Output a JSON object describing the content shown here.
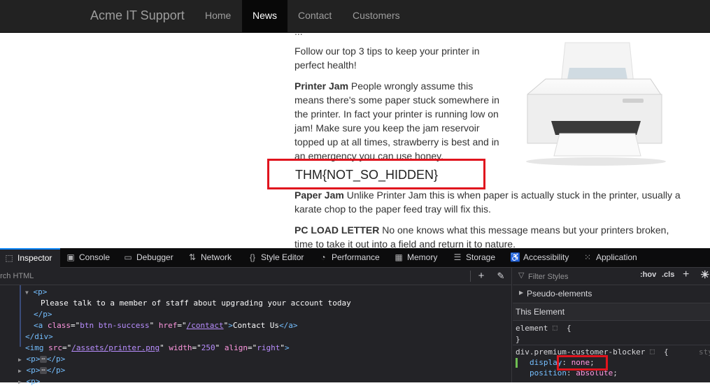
{
  "navbar": {
    "brand": "Acme IT Support",
    "items": [
      {
        "label": "Home"
      },
      {
        "label": "News"
      },
      {
        "label": "Contact"
      },
      {
        "label": "Customers"
      }
    ]
  },
  "article": {
    "top_partial": "...",
    "intro": "Follow our top 3 tips to keep your printer in perfect health!",
    "tips": [
      {
        "title": "Printer Jam",
        "text": " People wrongly assume this means there's some paper stuck somewhere in the printer. In fact your printer is running low on jam! Make sure you keep the jam reservoir topped up at all times, strawberry is best and in an emergency you can use honey."
      },
      {
        "title": "Paper Jam",
        "text": " Unlike Printer Jam this is when paper is actually stuck in the printer, usually a karate chop to the paper feed tray will fix this."
      },
      {
        "title": "PC LOAD LETTER",
        "text": " No one knows what this message means but your printers broken, time to take it out into a field and return it to nature."
      }
    ],
    "flag": "THM{NOT_SO_HIDDEN}"
  },
  "devtools": {
    "tabs": [
      {
        "label": "Inspector",
        "icon": "inspector-icon"
      },
      {
        "label": "Console",
        "icon": "console-icon"
      },
      {
        "label": "Debugger",
        "icon": "debugger-icon"
      },
      {
        "label": "Network",
        "icon": "network-icon"
      },
      {
        "label": "Style Editor",
        "icon": "style-editor-icon"
      },
      {
        "label": "Performance",
        "icon": "performance-icon"
      },
      {
        "label": "Memory",
        "icon": "memory-icon"
      },
      {
        "label": "Storage",
        "icon": "storage-icon"
      },
      {
        "label": "Accessibility",
        "icon": "accessibility-icon"
      },
      {
        "label": "Application",
        "icon": "application-icon"
      }
    ],
    "search_placeholder": "arch HTML",
    "markup": {
      "p_open": "<p>",
      "p_text": "Please talk to a member of staff about upgrading your account today",
      "p_close": "</p>",
      "a_tag": "a",
      "a_class_attr": "class",
      "a_class_val": "btn btn-success",
      "a_href_attr": "href",
      "a_href_val": "/contact",
      "a_text": "Contact Us",
      "a_close": "</a>",
      "div_close": "</div>",
      "img_tag": "img",
      "img_src_attr": "src",
      "img_src_val": "/assets/printer.png",
      "img_width_attr": "width",
      "img_width_val": "250",
      "img_align_attr": "align",
      "img_align_val": "right",
      "p_collapsed": "p",
      "p_bottom": "<p>"
    },
    "rules": {
      "filter_placeholder": "Filter Styles",
      "hov": ":hov",
      "cls": ".cls",
      "pseudo_elements": "Pseudo-elements",
      "this_element": "This Element",
      "element_selector": "element",
      "open_brace": "{",
      "close_brace": "}",
      "premium_selector": "div.premium-customer-blocker",
      "source": "sty",
      "props": [
        {
          "name": "display",
          "value": "none"
        },
        {
          "name": "position",
          "value": "absolute"
        }
      ]
    }
  },
  "colors": {
    "highlight": "#e0141e",
    "navbar_bg": "#222222",
    "devtools_bg": "#232327",
    "active_tab": "#0a84ff"
  }
}
